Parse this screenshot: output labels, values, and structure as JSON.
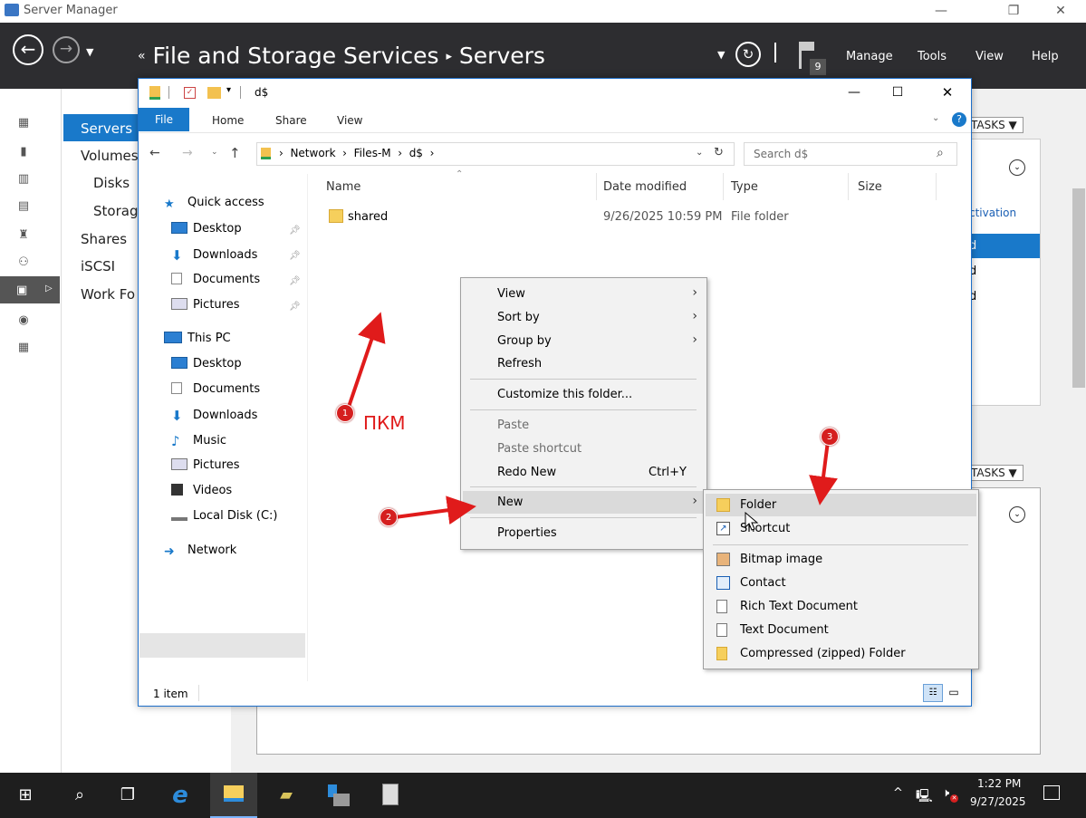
{
  "server_manager": {
    "window_title": "Server Manager",
    "breadcrumb": [
      "File and Storage Services",
      "Servers"
    ],
    "breadcrumb_prefix": "«",
    "notification_count": "9",
    "menu": [
      "Manage",
      "Tools",
      "View",
      "Help"
    ],
    "nav_items": [
      "Servers",
      "Volumes",
      "Disks",
      "Storag",
      "Shares",
      "iSCSI",
      "Work Fo"
    ],
    "tasks_label": "TASKS",
    "partial_text": {
      "activation": "ctivation",
      "row": "d"
    }
  },
  "explorer": {
    "title": "d$",
    "ribbon_tabs": [
      "File",
      "Home",
      "Share",
      "View"
    ],
    "address": [
      "Network",
      "Files-M",
      "d$"
    ],
    "search_placeholder": "Search d$",
    "sidebar": {
      "quick_access": "Quick access",
      "quick_items": [
        "Desktop",
        "Downloads",
        "Documents",
        "Pictures"
      ],
      "this_pc": "This PC",
      "pc_items": [
        "Desktop",
        "Documents",
        "Downloads",
        "Music",
        "Pictures",
        "Videos",
        "Local Disk (C:)"
      ],
      "network": "Network"
    },
    "columns": [
      "Name",
      "Date modified",
      "Type",
      "Size"
    ],
    "files": [
      {
        "name": "shared",
        "date": "9/26/2025 10:59 PM",
        "type": "File folder",
        "size": ""
      }
    ],
    "status": "1 item"
  },
  "context_menu": {
    "items": [
      {
        "label": "View",
        "submenu": true
      },
      {
        "label": "Sort by",
        "submenu": true
      },
      {
        "label": "Group by",
        "submenu": true
      },
      {
        "label": "Refresh"
      },
      {
        "label": "Customize this folder..."
      },
      {
        "label": "Paste",
        "disabled": true
      },
      {
        "label": "Paste shortcut",
        "disabled": true
      },
      {
        "label": "Redo New",
        "shortcut": "Ctrl+Y"
      },
      {
        "label": "New",
        "submenu": true,
        "highlighted": true
      },
      {
        "label": "Properties"
      }
    ]
  },
  "new_submenu": {
    "items": [
      "Folder",
      "Shortcut",
      "Bitmap image",
      "Contact",
      "Rich Text Document",
      "Text Document",
      "Compressed (zipped) Folder"
    ]
  },
  "annotations": {
    "badges": [
      "1",
      "2",
      "3"
    ],
    "label": "ПКМ",
    "color": "#e01b1b"
  },
  "taskbar": {
    "time": "1:22 PM",
    "date": "9/27/2025"
  }
}
